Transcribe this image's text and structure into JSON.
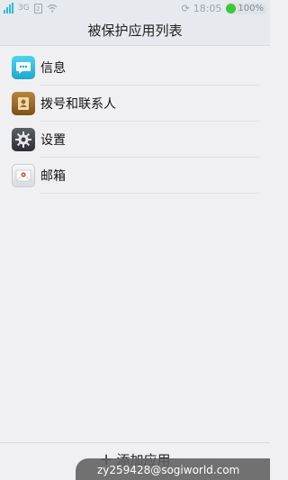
{
  "status_bar": {
    "network": "3G",
    "sim": "2",
    "time": "18:05",
    "battery": "100%",
    "icons": [
      "signal-icon",
      "sim-card-icon",
      "wifi-icon",
      "sync-icon",
      "battery-icon"
    ],
    "battery_color": "#3cc83c"
  },
  "header": {
    "title": "被保护应用列表"
  },
  "apps": [
    {
      "label": "信息",
      "icon": "message-icon"
    },
    {
      "label": "拨号和联系人",
      "icon": "contacts-icon"
    },
    {
      "label": "设置",
      "icon": "settings-icon"
    },
    {
      "label": "邮箱",
      "icon": "mail-icon"
    }
  ],
  "footer": {
    "plus": "+",
    "add_label": "添加应用"
  },
  "watermark": {
    "text": "zy259428@sogiworld.com"
  }
}
